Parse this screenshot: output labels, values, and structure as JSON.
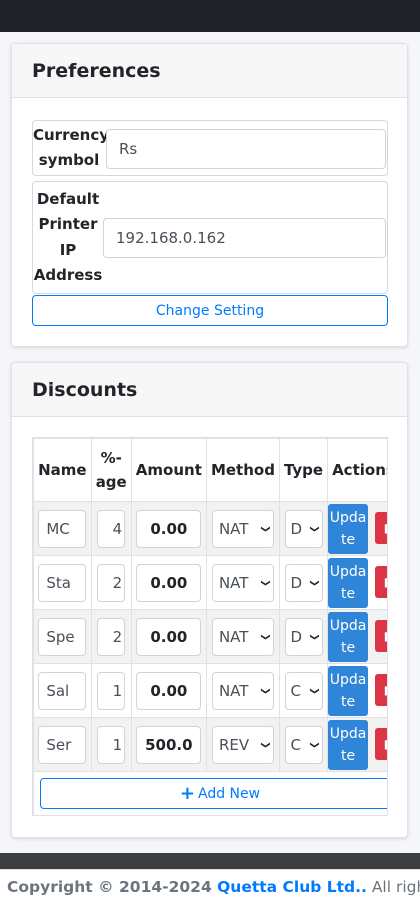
{
  "preferences": {
    "title": "Preferences",
    "currency_label_1": "Currency",
    "currency_label_2": "symbol",
    "currency_value": "Rs",
    "printer_label_1": "Default",
    "printer_label_2": "Printer",
    "printer_label_3": "IP",
    "printer_label_4": "Address",
    "printer_value": "192.168.0.162",
    "change_button": "Change Setting"
  },
  "discounts": {
    "title": "Discounts",
    "headers": {
      "name": "Name",
      "pct_1": "%-",
      "pct_2": "age",
      "amount": "Amount",
      "method": "Method",
      "type": "Type",
      "actions": "Actions"
    },
    "rows": [
      {
        "name": "MC",
        "pct": "4",
        "amount": "0.00",
        "method": "NAT",
        "type": "D",
        "update_1": "Upda",
        "update_2": "te"
      },
      {
        "name": "Sta",
        "pct": "2",
        "amount": "0.00",
        "method": "NAT",
        "type": "D",
        "update_1": "Upda",
        "update_2": "te"
      },
      {
        "name": "Spe",
        "pct": "2",
        "amount": "0.00",
        "method": "NAT",
        "type": "D",
        "update_1": "Upda",
        "update_2": "te"
      },
      {
        "name": "Sal",
        "pct": "1",
        "amount": "0.00",
        "method": "NAT",
        "type": "C",
        "update_1": "Upda",
        "update_2": "te"
      },
      {
        "name": "Ser",
        "pct": "1",
        "amount": "500.0",
        "method": "REV",
        "type": "C",
        "update_1": "Upda",
        "update_2": "te"
      }
    ],
    "add_new": "Add New",
    "add_icon": "plus-icon",
    "delete_icon": "trash-icon"
  },
  "footer": {
    "copyright": "Copyright © 2014-2024 ",
    "brand": "Quetta Club Ltd..",
    "rights": " All rights"
  },
  "colors": {
    "primary": "#007bff",
    "update_button": "#2f86d8",
    "delete_button": "#dc3545",
    "topbar": "#1f2327"
  }
}
